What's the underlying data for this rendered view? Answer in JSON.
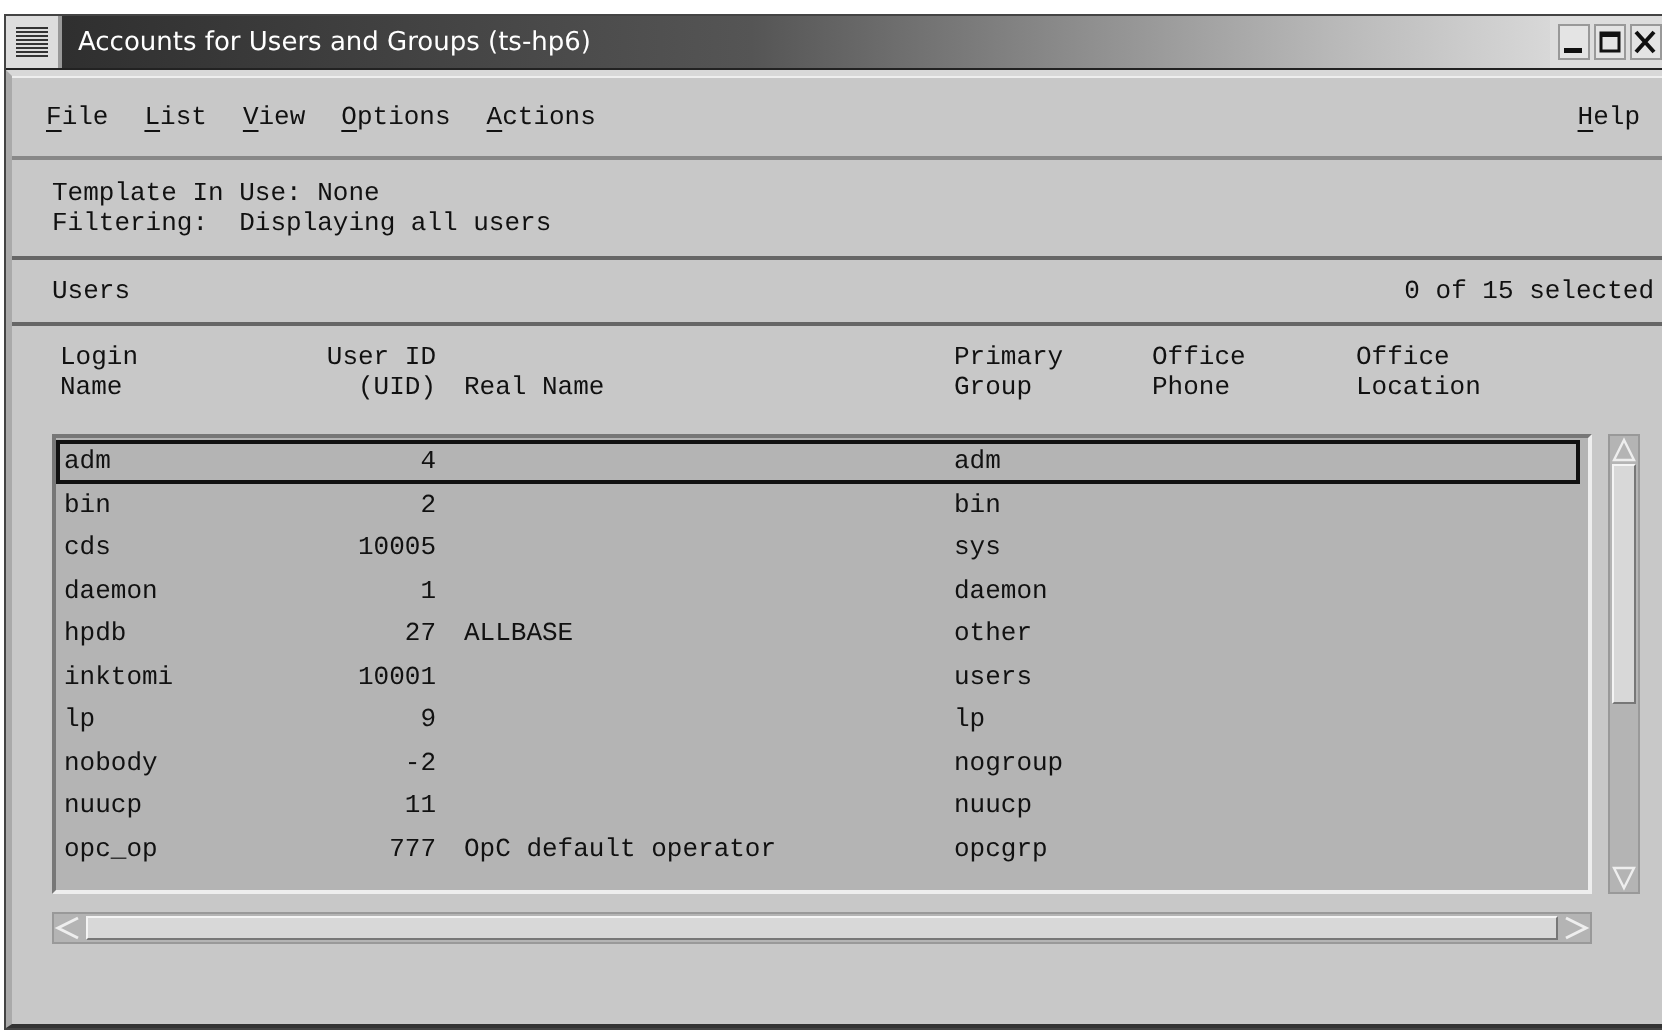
{
  "window": {
    "title": "Accounts for Users and Groups (ts-hp6)"
  },
  "menu": [
    {
      "key": "F",
      "rest": "ile"
    },
    {
      "key": "L",
      "rest": "ist"
    },
    {
      "key": "V",
      "rest": "iew"
    },
    {
      "key": "O",
      "rest": "ptions"
    },
    {
      "key": "A",
      "rest": "ctions"
    }
  ],
  "help_menu": {
    "key": "H",
    "rest": "elp"
  },
  "info": [
    "Template In Use: None",
    "Filtering:  Displaying all users"
  ],
  "list_header": {
    "title": "Users",
    "count": "0 of 15 selected"
  },
  "table": {
    "columns": [
      {
        "line1": "Login",
        "line2": "Name"
      },
      {
        "line1": "User ID",
        "line2": "(UID)"
      },
      {
        "line2": "Real Name"
      },
      {
        "line1": "Primary",
        "line2": "Group"
      },
      {
        "line1": "Office",
        "line2": "Phone"
      },
      {
        "line1": "Office",
        "line2": "Location"
      }
    ],
    "rows": [
      {
        "cells": [
          "adm",
          "4",
          "",
          "adm"
        ],
        "focused": true
      },
      {
        "cells": [
          "bin",
          "2",
          "",
          "bin"
        ],
        "focused": false
      },
      {
        "cells": [
          "cds",
          "10005",
          "",
          "sys"
        ],
        "focused": false
      },
      {
        "cells": [
          "daemon",
          "1",
          "",
          "daemon"
        ],
        "focused": false
      },
      {
        "cells": [
          "hpdb",
          "27",
          "ALLBASE",
          "other"
        ],
        "focused": false
      },
      {
        "cells": [
          "inktomi",
          "10001",
          "",
          "users"
        ],
        "focused": false
      },
      {
        "cells": [
          "lp",
          "9",
          "",
          "lp"
        ],
        "focused": false
      },
      {
        "cells": [
          "nobody",
          "-2",
          "",
          "nogroup"
        ],
        "focused": false
      },
      {
        "cells": [
          "nuucp",
          "11",
          "",
          "nuucp"
        ],
        "focused": false
      },
      {
        "cells": [
          "opc_op",
          "777",
          "OpC default operator",
          "opcgrp"
        ],
        "focused": false
      }
    ]
  }
}
